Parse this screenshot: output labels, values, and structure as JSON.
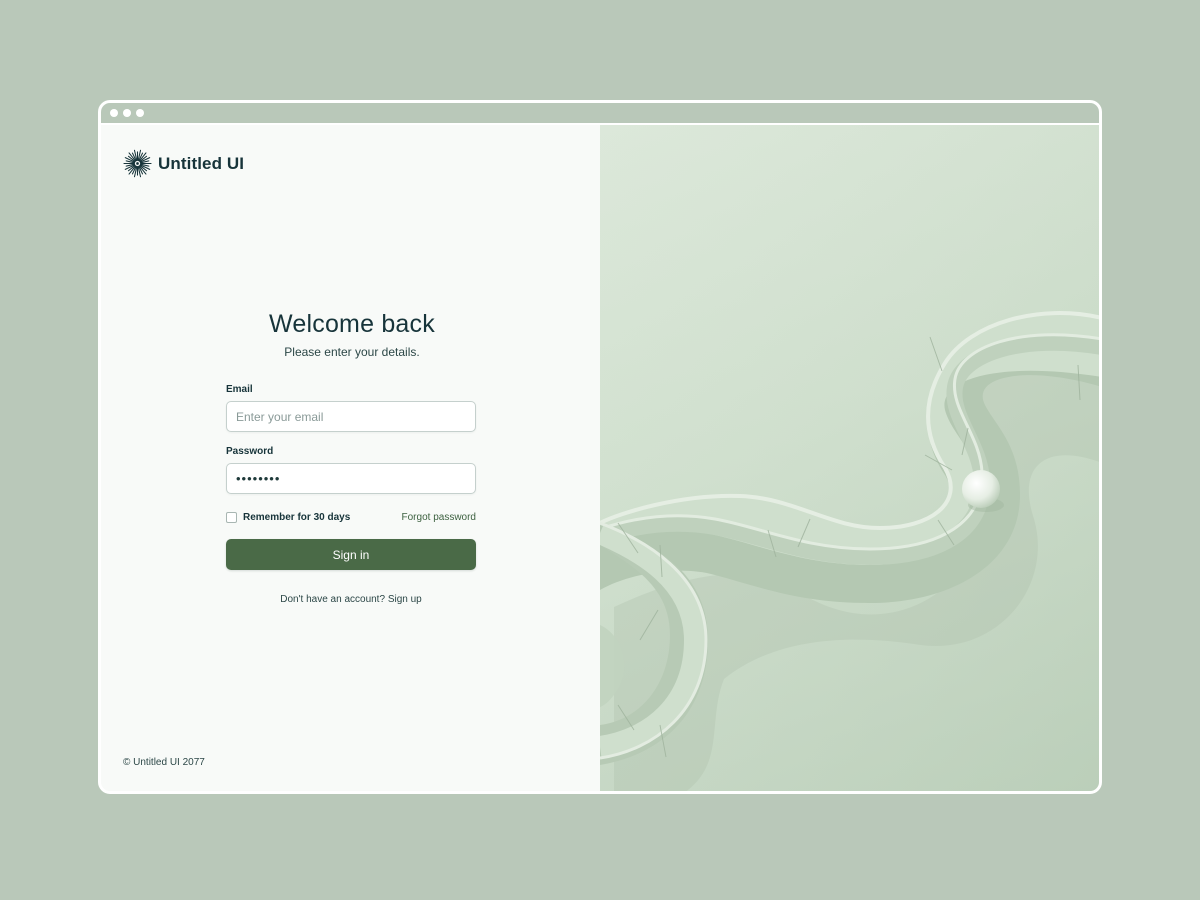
{
  "brand": {
    "name": "Untitled UI",
    "logo_icon": "sunburst-icon"
  },
  "login": {
    "heading": "Welcome back",
    "subheading": "Please enter your details.",
    "email": {
      "label": "Email",
      "placeholder": "Enter your email",
      "value": ""
    },
    "password": {
      "label": "Password",
      "value": "••••••••"
    },
    "remember_label": "Remember for 30 days",
    "remember_checked": false,
    "forgot_label": "Forgot password",
    "submit_label": "Sign in",
    "signup_prompt": "Don't have an account?",
    "signup_link": "Sign up"
  },
  "footer": {
    "copyright": "© Untitled UI 2077"
  },
  "colors": {
    "page_background": "#b9c8b9",
    "primary_button": "#4a6a47",
    "heading_text": "#17343a",
    "illustration_background": "#d3e2d1"
  }
}
